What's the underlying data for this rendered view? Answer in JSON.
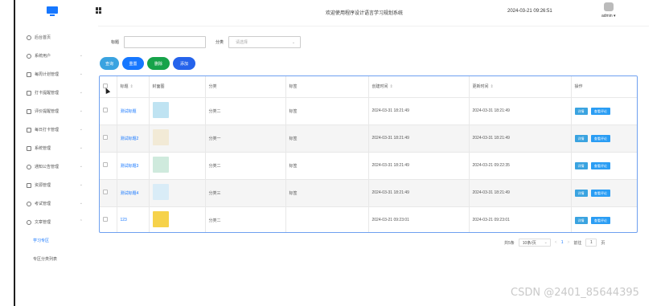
{
  "header": {
    "site_title": "欢迎使用程序设计语言学习规划系统",
    "datetime": "2024-03-21 09:26:51",
    "username": "admin ▾"
  },
  "sidebar": {
    "items": [
      {
        "label": "后台首页",
        "icon": "clock-icon",
        "has_chevron": false
      },
      {
        "label": "系统用户",
        "icon": "user-icon",
        "has_chevron": true
      },
      {
        "label": "每周计划管理",
        "icon": "calendar-icon",
        "has_chevron": true
      },
      {
        "label": "打卡提醒管理",
        "icon": "bell-icon",
        "has_chevron": true
      },
      {
        "label": "评价提醒管理",
        "icon": "comment-icon",
        "has_chevron": true
      },
      {
        "label": "每日打卡管理",
        "icon": "checkin-icon",
        "has_chevron": true
      },
      {
        "label": "系统管理",
        "icon": "settings-icon",
        "has_chevron": true
      },
      {
        "label": "通知公告管理",
        "icon": "bulb-icon",
        "has_chevron": true
      },
      {
        "label": "资源管理",
        "icon": "folder-icon",
        "has_chevron": true
      },
      {
        "label": "考试管理",
        "icon": "exam-icon",
        "has_chevron": true
      },
      {
        "label": "文章管理",
        "icon": "headset-icon",
        "has_chevron": true,
        "expanded": true
      }
    ],
    "sub_items": [
      {
        "label": "学习专区",
        "active": true
      },
      {
        "label": "专区分类列表",
        "active": false
      }
    ]
  },
  "search": {
    "title_label": "标题",
    "title_placeholder": "",
    "category_label": "分类",
    "category_placeholder": "请选择"
  },
  "actions": {
    "search": "查询",
    "reset": "重置",
    "delete": "删除",
    "add": "添加"
  },
  "table": {
    "columns": [
      "标题",
      "封面图",
      "分类",
      "标签",
      "创建时间",
      "更新时间",
      "操作"
    ],
    "rows": [
      {
        "title": "测试标题",
        "category": "分类二",
        "tag": "标签",
        "created": "2024-03-31 18:21:49",
        "updated": "2024-03-31 18:21:49",
        "cover_color": "#bfe3f2"
      },
      {
        "title": "测试标题2",
        "category": "分类一",
        "tag": "标签",
        "created": "2024-03-31 18:21:49",
        "updated": "2024-03-31 18:21:49",
        "cover_color": "#f2ead6"
      },
      {
        "title": "测试标题3",
        "category": "分类二",
        "tag": "标签",
        "created": "2024-03-31 18:21:49",
        "updated": "2024-03-21 09:22:35",
        "cover_color": "#cfeadd"
      },
      {
        "title": "测试标题4",
        "category": "分类三",
        "tag": "标签",
        "created": "2024-03-31 18:21:49",
        "updated": "2024-03-31 18:21:49",
        "cover_color": "#d9ecf7"
      },
      {
        "title": "123",
        "category": "分类二",
        "tag": "",
        "created": "2024-03-21 09:23:01",
        "updated": "2024-03-21 09:23:01",
        "cover_color": "#f6d24a"
      }
    ],
    "op_detail": "详情",
    "op_comment": "查看评论"
  },
  "pager": {
    "total": "共5条",
    "size": "10条/页",
    "prev": "<",
    "current": "1",
    "next": ">",
    "goto_label": "前往",
    "goto_value": "1",
    "page_suffix": "页"
  },
  "watermark": "CSDN @2401_85644395"
}
